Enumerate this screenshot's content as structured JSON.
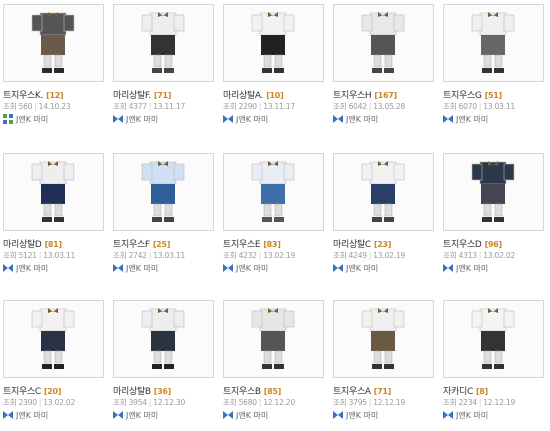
{
  "colors": {
    "count": "#c8872a",
    "meta": "#9a9a9a",
    "border": "#d6d6d6",
    "author_icon": "#3a6fc4"
  },
  "rows": [
    [
      {
        "title": "트지우스K.",
        "count": "[12]",
        "views_label": "조회",
        "views": "560",
        "date": "14.10.23",
        "author": "J앤K 마미",
        "icon": "grid-icon"
      },
      {
        "title": "마리상탈F.",
        "count": "[71]",
        "views_label": "조회",
        "views": "4377",
        "date": "13.11.17",
        "author": "J앤K 마미",
        "icon": "bow-icon"
      },
      {
        "title": "마리상탈A.",
        "count": "[10]",
        "views_label": "조회",
        "views": "2290",
        "date": "13.11.17",
        "author": "J앤K 마미",
        "icon": "bow-icon"
      },
      {
        "title": "트지우스H",
        "count": "[167]",
        "views_label": "조회",
        "views": "6042",
        "date": "13.05.28",
        "author": "J앤K 마미",
        "icon": "bow-icon"
      },
      {
        "title": "트지우스G",
        "count": "[51]",
        "views_label": "조회",
        "views": "6070",
        "date": "13.03.11",
        "author": "J앤K 마미",
        "icon": "bow-icon"
      }
    ],
    [
      {
        "title": "마리상탈D",
        "count": "[81]",
        "views_label": "조회",
        "views": "5121",
        "date": "13.03.11",
        "author": "J앤K 마미",
        "icon": "bow-icon"
      },
      {
        "title": "트지우스F",
        "count": "[25]",
        "views_label": "조회",
        "views": "2742",
        "date": "13.03.11",
        "author": "J앤K 마미",
        "icon": "bow-icon"
      },
      {
        "title": "트지우스E",
        "count": "[83]",
        "views_label": "조회",
        "views": "4232",
        "date": "13.02.19",
        "author": "J앤K 마미",
        "icon": "bow-icon"
      },
      {
        "title": "마리상탈C",
        "count": "[23]",
        "views_label": "조회",
        "views": "4249",
        "date": "13.02.19",
        "author": "J앤K 마미",
        "icon": "bow-icon"
      },
      {
        "title": "트지우스D",
        "count": "[96]",
        "views_label": "조회",
        "views": "4313",
        "date": "13.02.02",
        "author": "J앤K 마미",
        "icon": "bow-icon"
      }
    ],
    [
      {
        "title": "트지우스C",
        "count": "[20]",
        "views_label": "조회",
        "views": "2390",
        "date": "13.02.02",
        "author": "J앤K 마미",
        "icon": "bow-icon"
      },
      {
        "title": "마리상탈B",
        "count": "[36]",
        "views_label": "조회",
        "views": "3954",
        "date": "12.12.30",
        "author": "J앤K 마미",
        "icon": "bow-icon"
      },
      {
        "title": "트지우스B",
        "count": "[85]",
        "views_label": "조회",
        "views": "5680",
        "date": "12.12.20",
        "author": "J앤K 마미",
        "icon": "bow-icon"
      },
      {
        "title": "트지우스A",
        "count": "[71]",
        "views_label": "조회",
        "views": "3795",
        "date": "12.12.19",
        "author": "J앤K 마미",
        "icon": "bow-icon"
      },
      {
        "title": "자카디C",
        "count": "[8]",
        "views_label": "조회",
        "views": "2234",
        "date": "12.12.19",
        "author": "J앤K 마미",
        "icon": "bow-icon"
      }
    ]
  ]
}
